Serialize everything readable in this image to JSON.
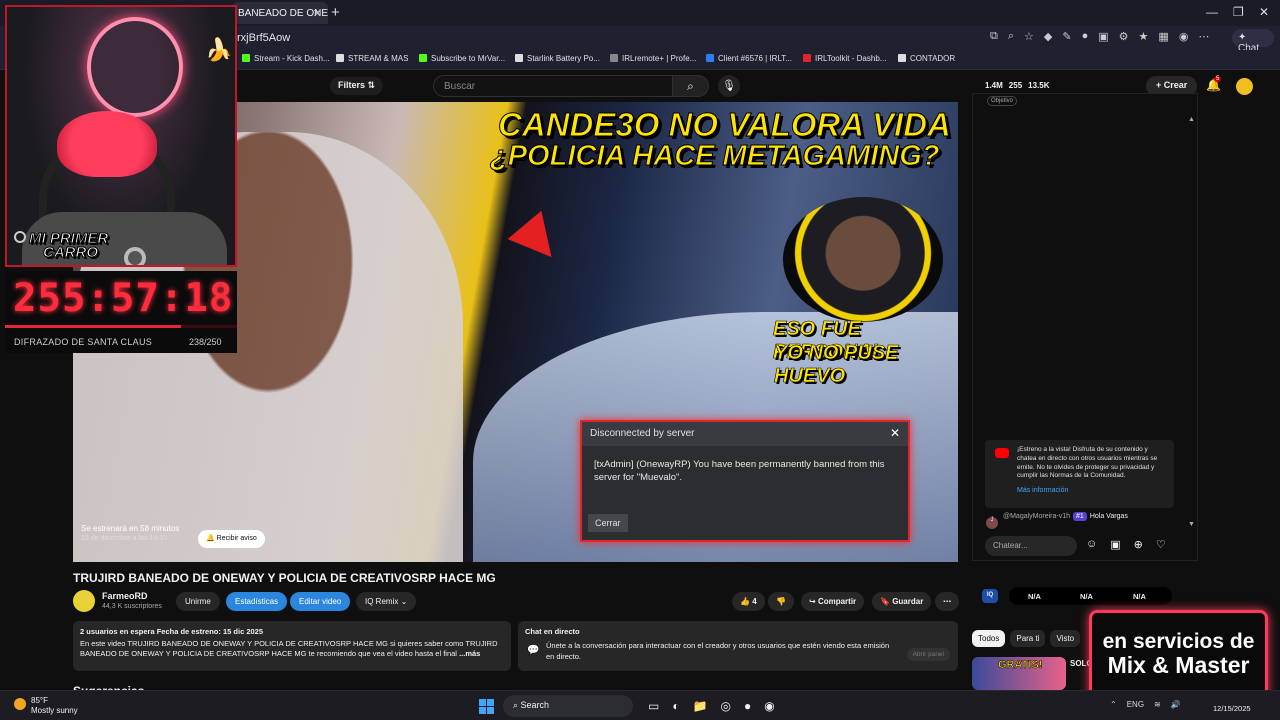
{
  "browser": {
    "tab_title": "BANEADO DE ONEWA",
    "url": "rxjBrf5Aow",
    "copilot_label": "Chat",
    "bookmarks": [
      {
        "label": "Stream - Kick Dash...",
        "color": "#53fc18"
      },
      {
        "label": "STREAM & MAS",
        "color": "#dddddd"
      },
      {
        "label": "Subscribe to MrVar...",
        "color": "#53fc18"
      },
      {
        "label": "Starlink Battery Po...",
        "color": "#dddddd"
      },
      {
        "label": "IRLremote+ | Profe...",
        "color": "#888888"
      },
      {
        "label": "Client #6576 | IRLT...",
        "color": "#2f7df5"
      },
      {
        "label": "IRLToolkit - Dashb...",
        "color": "#e0262b"
      },
      {
        "label": "CONTADOR",
        "color": "#dddddd"
      }
    ]
  },
  "yt_header": {
    "filters_label": "Filters",
    "search_placeholder": "Buscar",
    "stats": [
      "1.4M",
      "255",
      "13.5K"
    ],
    "create_label": "Crear",
    "notif_count": "5"
  },
  "video": {
    "thumb_title_line1": "CANDE3O NO VALORA VIDA",
    "thumb_title_line2": "¿POLICIA HACE METAGAMING?",
    "thumb_caption_line1": "ESO FUE PERSONAL",
    "thumb_caption_line2": "YO NO PUSE HUEVO",
    "dialog_title": "Disconnected by server",
    "dialog_message": "[txAdmin] (OnewayRP) You have been permanently banned from this server for \"Muevalo\".",
    "dialog_button": "Cerrar",
    "premiere_label": "Se estrenará en 58 minutos",
    "premiere_date": "15 de diciembre a las 14:15",
    "remind_label": "Recibir aviso"
  },
  "info": {
    "title": "TRUJIRD BANEADO DE ONEWAY Y POLICIA DE CREATIVOSRP HACE MG",
    "channel": "FarmeoRD",
    "subscribers": "44,3 K suscriptores",
    "subscribe_label": "Unirme",
    "stats_label": "Estadísticas",
    "edit_label": "Editar video",
    "remix_label": "Remix",
    "likes": "4",
    "share_label": "Compartir",
    "save_label": "Guardar",
    "desc_meta": "2 usuarios en espera  Fecha de estreno: 15 dic 2025",
    "desc_text": "En este video TRUJIRD BANEADO DE ONEWAY Y POLICIA DE CREATIVOSRP HACE MG si quieres saber como TRUJIRD BANEADO DE ONEWAY Y POLICIA DE CREATIVOSRP HACE MG te recomiendo que vea el video hasta el final",
    "desc_more": "...más",
    "chat_heading": "Chat en directo",
    "chat_text": "Únete a la conversación para interactuar con el creador y otros usuarios que estén viendo esta emisión en directo.",
    "open_panel": "Abrir panel",
    "next_heading": "Sugerencias"
  },
  "chat": {
    "top_chip": "Objetivo",
    "notice_text": "¡Estreno a la vista! Disfruta de su contenido y chatea en directo con otros usuarios mientras se emite. No te olvides de proteger su privacidad y cumplir las Normas de la Comunidad.",
    "notice_link": "Más información",
    "msg_initial": "J",
    "msg_user": "@MagalyMoreira-v1h",
    "msg_badge": "#1",
    "msg_text": "Hola Vargas",
    "input_placeholder": "Chatear..."
  },
  "extension": {
    "logo": "IQ",
    "values": [
      "N/A",
      "N/A",
      "N/A"
    ]
  },
  "recommendations": {
    "tabs": [
      "Todos",
      "Para ti",
      "Visto"
    ],
    "thumb_text": "GRATIS!",
    "title": "SOLO"
  },
  "overlay": {
    "car_line1": "MI PRIMER",
    "car_line2": "CARRO",
    "timer": "255:57:18",
    "goal_label": "DIFRAZADO DE SANTA CLAUS",
    "goal_count": "238/250",
    "goal_progress": 0.76,
    "promo_line1": "en servicios de",
    "promo_line2": "Mix & Master"
  },
  "taskbar": {
    "temp": "85°F",
    "weather": "Mostly sunny",
    "search_label": "Search",
    "lang": "ENG",
    "date": "12/15/2025"
  }
}
